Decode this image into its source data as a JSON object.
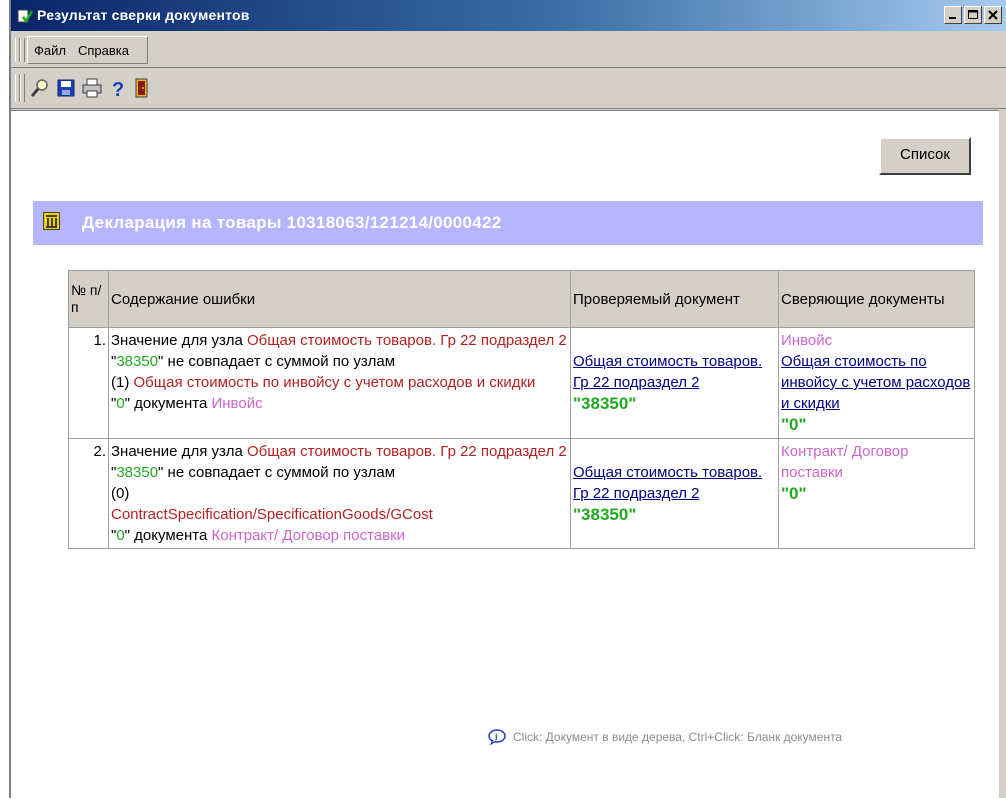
{
  "window": {
    "title": "Результат сверки документов"
  },
  "menu": {
    "items": [
      "Файл",
      "Справка"
    ]
  },
  "toolbar": {
    "icons": [
      "search-icon",
      "save-icon",
      "print-icon",
      "help-icon",
      "exit-icon"
    ]
  },
  "list_button": "Список",
  "declaration": {
    "title": "Декларация на товары 10318063/121214/0000422"
  },
  "table": {
    "headers": {
      "num": "№ п/п",
      "error": "Содержание ошибки",
      "checked": "Проверяемый документ",
      "reconciling": "Сверяющие документы"
    },
    "rows": [
      {
        "num": "1.",
        "e_prefix": "Значение для узла ",
        "e_node": "Общая стоимость товаров. Гр 22 подраздел 2",
        "e_value": "38350",
        "e_mid": "\" не совпадает с суммой по узлам",
        "e_count": "(1) ",
        "e_path": "Общая стоимость по инвойсу с учетом расходов и скидки",
        "e_zero": "0",
        "e_doc_label": "\" документа ",
        "e_doc_name": "Инвойс",
        "checked_link": "Общая стоимость товаров. Гр 22 подраздел 2",
        "checked_value": "\"38350\"",
        "rec_name": "Инвойс",
        "rec_link": "Общая стоимость по инвойсу с учетом расходов и скидки",
        "rec_value": "\"0\""
      },
      {
        "num": "2.",
        "e_prefix": "Значение для узла ",
        "e_node": "Общая стоимость товаров. Гр 22 подраздел 2",
        "e_value": "38350",
        "e_mid": "\" не совпадает с суммой по узлам",
        "e_count": "(0)",
        "e_path": "ContractSpecification/SpecificationGoods/GCost",
        "e_zero": "0",
        "e_doc_label": "\" документа ",
        "e_doc_name": "Контракт/ Договор поставки",
        "checked_link": "Общая стоимость товаров. Гр 22 подраздел 2",
        "checked_value": "\"38350\"",
        "rec_name": "Контракт/ Договор поставки",
        "rec_value": "\"0\""
      }
    ]
  },
  "hint": "Click: Документ в виде дерева, Ctrl+Click: Бланк документа"
}
